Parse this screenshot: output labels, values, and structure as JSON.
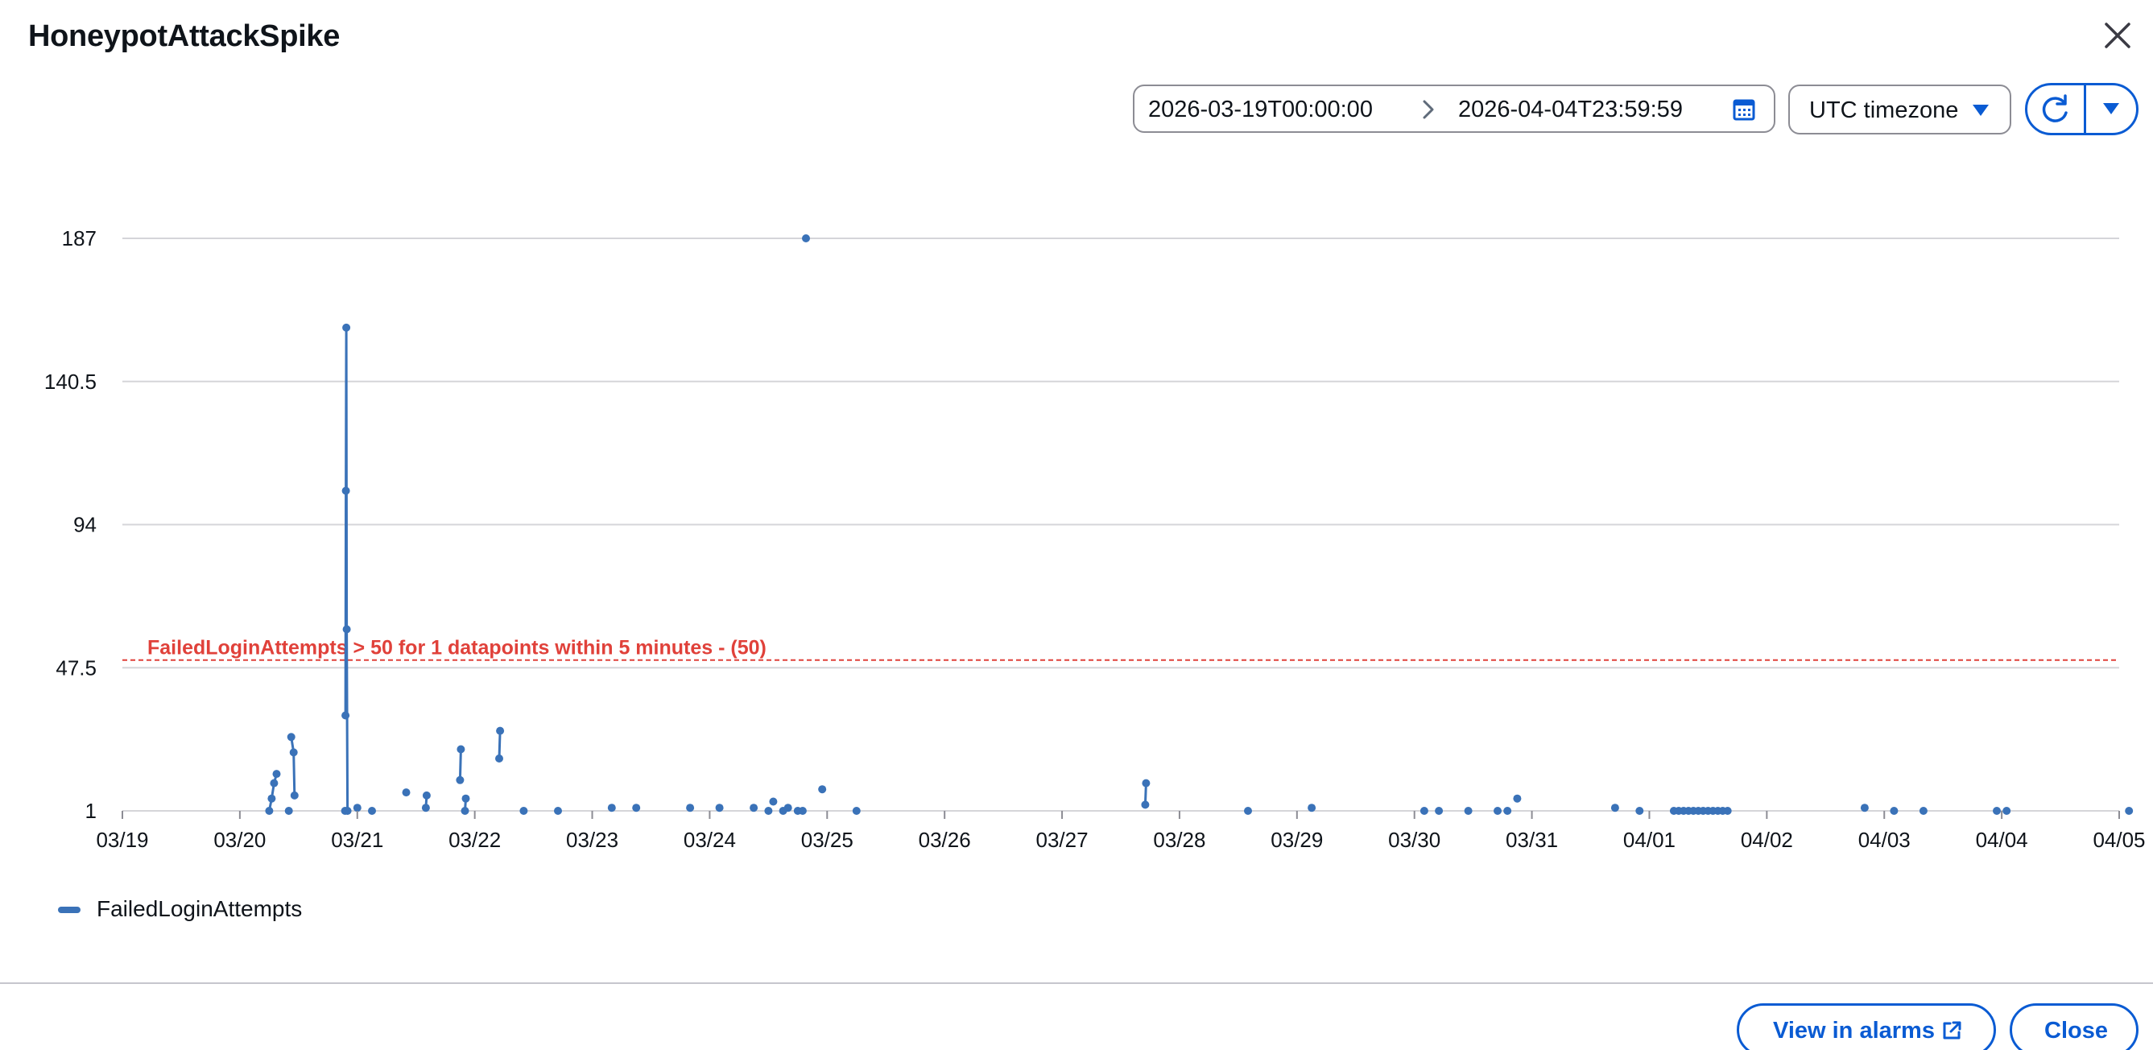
{
  "modal": {
    "title": "HoneypotAttackSpike"
  },
  "toolbar": {
    "date_start": "2026-03-19T00:00:00",
    "date_end": "2026-04-04T23:59:59",
    "timezone": "UTC timezone"
  },
  "footer": {
    "view_in_alarms_label": "View in alarms",
    "close_label": "Close"
  },
  "legend": {
    "items": [
      {
        "label": "FailedLoginAttempts",
        "color": "#3a72b8"
      }
    ]
  },
  "colors": {
    "accent": "#0a5bd3",
    "series": "#3a72b8",
    "threshold": "#e0413a",
    "grid": "#d5d5d9"
  },
  "chart_data": {
    "type": "scatter",
    "series": [
      {
        "name": "FailedLoginAttempts",
        "color": "#3a72b8",
        "points": [
          {
            "x": "2026-03-20T06:00",
            "y": 1
          },
          {
            "x": "2026-03-20T06:30",
            "y": 5
          },
          {
            "x": "2026-03-20T07:00",
            "y": 10
          },
          {
            "x": "2026-03-20T07:30",
            "y": 13
          },
          {
            "x": "2026-03-20T10:00",
            "y": 1
          },
          {
            "x": "2026-03-20T10:30",
            "y": 25
          },
          {
            "x": "2026-03-20T11:00",
            "y": 20
          },
          {
            "x": "2026-03-20T11:10",
            "y": 6
          },
          {
            "x": "2026-03-20T21:30",
            "y": 1
          },
          {
            "x": "2026-03-20T21:35",
            "y": 32
          },
          {
            "x": "2026-03-20T21:40",
            "y": 105
          },
          {
            "x": "2026-03-20T21:45",
            "y": 158
          },
          {
            "x": "2026-03-20T21:50",
            "y": 60
          },
          {
            "x": "2026-03-20T22:00",
            "y": 1
          },
          {
            "x": "2026-03-21T00:00",
            "y": 2
          },
          {
            "x": "2026-03-21T03:00",
            "y": 1
          },
          {
            "x": "2026-03-21T10:00",
            "y": 7
          },
          {
            "x": "2026-03-21T14:00",
            "y": 2
          },
          {
            "x": "2026-03-21T14:10",
            "y": 6
          },
          {
            "x": "2026-03-21T21:00",
            "y": 11
          },
          {
            "x": "2026-03-21T21:10",
            "y": 21
          },
          {
            "x": "2026-03-21T22:00",
            "y": 1
          },
          {
            "x": "2026-03-21T22:10",
            "y": 5
          },
          {
            "x": "2026-03-22T05:00",
            "y": 18
          },
          {
            "x": "2026-03-22T05:10",
            "y": 27
          },
          {
            "x": "2026-03-22T10:00",
            "y": 1
          },
          {
            "x": "2026-03-22T17:00",
            "y": 1
          },
          {
            "x": "2026-03-23T04:00",
            "y": 2
          },
          {
            "x": "2026-03-23T09:00",
            "y": 2
          },
          {
            "x": "2026-03-23T20:00",
            "y": 2
          },
          {
            "x": "2026-03-24T02:00",
            "y": 2
          },
          {
            "x": "2026-03-24T09:00",
            "y": 2
          },
          {
            "x": "2026-03-24T12:00",
            "y": 1
          },
          {
            "x": "2026-03-24T13:00",
            "y": 4
          },
          {
            "x": "2026-03-24T15:00",
            "y": 1
          },
          {
            "x": "2026-03-24T16:00",
            "y": 2
          },
          {
            "x": "2026-03-24T18:00",
            "y": 1
          },
          {
            "x": "2026-03-24T19:00",
            "y": 1
          },
          {
            "x": "2026-03-24T19:40",
            "y": 187
          },
          {
            "x": "2026-03-24T23:00",
            "y": 8
          },
          {
            "x": "2026-03-25T06:00",
            "y": 1
          },
          {
            "x": "2026-03-27T17:00",
            "y": 3
          },
          {
            "x": "2026-03-27T17:10",
            "y": 10
          },
          {
            "x": "2026-03-28T14:00",
            "y": 1
          },
          {
            "x": "2026-03-29T03:00",
            "y": 2
          },
          {
            "x": "2026-03-30T02:00",
            "y": 1
          },
          {
            "x": "2026-03-30T05:00",
            "y": 1
          },
          {
            "x": "2026-03-30T11:00",
            "y": 1
          },
          {
            "x": "2026-03-30T17:00",
            "y": 1
          },
          {
            "x": "2026-03-30T19:00",
            "y": 1
          },
          {
            "x": "2026-03-30T21:00",
            "y": 5
          },
          {
            "x": "2026-03-31T17:00",
            "y": 2
          },
          {
            "x": "2026-03-31T22:00",
            "y": 1
          },
          {
            "x": "2026-04-01T05:00",
            "y": 1
          },
          {
            "x": "2026-04-01T06:00",
            "y": 1
          },
          {
            "x": "2026-04-01T07:00",
            "y": 1
          },
          {
            "x": "2026-04-01T08:00",
            "y": 1
          },
          {
            "x": "2026-04-01T09:00",
            "y": 1
          },
          {
            "x": "2026-04-01T10:00",
            "y": 1
          },
          {
            "x": "2026-04-01T11:00",
            "y": 1
          },
          {
            "x": "2026-04-01T12:00",
            "y": 1
          },
          {
            "x": "2026-04-01T13:00",
            "y": 1
          },
          {
            "x": "2026-04-01T14:00",
            "y": 1
          },
          {
            "x": "2026-04-01T15:00",
            "y": 1
          },
          {
            "x": "2026-04-01T16:00",
            "y": 1
          },
          {
            "x": "2026-04-02T20:00",
            "y": 2
          },
          {
            "x": "2026-04-03T02:00",
            "y": 1
          },
          {
            "x": "2026-04-03T08:00",
            "y": 1
          },
          {
            "x": "2026-04-03T23:00",
            "y": 1
          },
          {
            "x": "2026-04-04T01:00",
            "y": 1
          },
          {
            "x": "2026-04-05T02:00",
            "y": 1
          }
        ]
      }
    ],
    "segments": [
      [
        "2026-03-20T06:00",
        "2026-03-20T06:30",
        "2026-03-20T07:00",
        "2026-03-20T07:30"
      ],
      [
        "2026-03-20T10:30",
        "2026-03-20T11:00",
        "2026-03-20T11:10"
      ],
      [
        "2026-03-20T21:35",
        "2026-03-20T21:40",
        "2026-03-20T21:45",
        "2026-03-20T21:50",
        "2026-03-20T22:00"
      ],
      [
        "2026-03-21T14:00",
        "2026-03-21T14:10"
      ],
      [
        "2026-03-21T21:00",
        "2026-03-21T21:10"
      ],
      [
        "2026-03-21T22:00",
        "2026-03-21T22:10"
      ],
      [
        "2026-03-22T05:00",
        "2026-03-22T05:10"
      ],
      [
        "2026-03-27T17:00",
        "2026-03-27T17:10"
      ]
    ],
    "threshold": {
      "value": 50,
      "label": "FailedLoginAttempts > 50 for 1 datapoints within 5 minutes - (50)",
      "color": "#e0413a"
    },
    "x_range": [
      "2026-03-19T00:00",
      "2026-04-05T00:00"
    ],
    "x_ticks": [
      "03/19",
      "03/20",
      "03/21",
      "03/22",
      "03/23",
      "03/24",
      "03/25",
      "03/26",
      "03/27",
      "03/28",
      "03/29",
      "03/30",
      "03/31",
      "04/01",
      "04/02",
      "04/03",
      "04/04",
      "04/05"
    ],
    "y_ticks": [
      1,
      47.5,
      94,
      140.5,
      187
    ],
    "ylim": [
      1,
      187
    ],
    "grid": true,
    "legend_position": "bottom-left"
  }
}
